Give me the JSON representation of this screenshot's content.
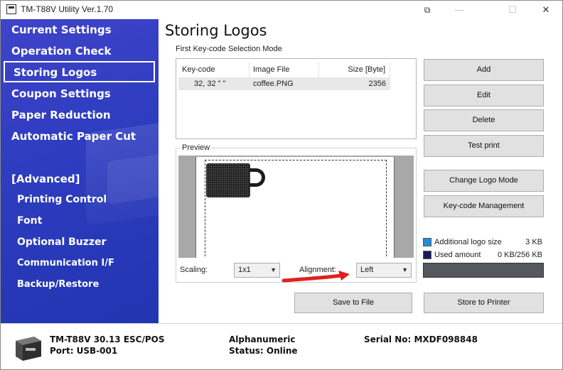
{
  "window": {
    "title": "TM-T88V Utility Ver.1.70"
  },
  "sidebar": {
    "items": [
      {
        "label": "Current Settings"
      },
      {
        "label": "Operation Check"
      },
      {
        "label": "Storing Logos"
      },
      {
        "label": "Coupon Settings"
      },
      {
        "label": "Paper Reduction"
      },
      {
        "label": "Automatic Paper Cut"
      },
      {
        "label": "[Advanced]"
      },
      {
        "label": "Printing Control"
      },
      {
        "label": "Font"
      },
      {
        "label": "Optional Buzzer"
      },
      {
        "label": "Communication I/F"
      },
      {
        "label": "Backup/Restore"
      }
    ],
    "active": "Storing Logos"
  },
  "main": {
    "title": "Storing Logos",
    "mode_label": "First Key-code Selection Mode",
    "table": {
      "columns": [
        "Key-code",
        "Image File",
        "Size [Byte]"
      ],
      "rows": [
        {
          "keycode": "32, 32  \" \"",
          "file": "coffee.PNG",
          "size": "2356"
        }
      ]
    },
    "preview": {
      "label": "Preview",
      "scaling_label": "Scaling:",
      "scaling_value": "1x1",
      "alignment_label": "Alignment:",
      "alignment_value": "Left"
    },
    "buttons": {
      "add": "Add",
      "edit": "Edit",
      "delete": "Delete",
      "test_print": "Test print",
      "change_logo_mode": "Change Logo Mode",
      "keycode_management": "Key-code Management",
      "save_to_file": "Save to File",
      "store_to_printer": "Store to Printer"
    },
    "usage": {
      "additional_label": "Additional logo size",
      "additional_value": "3 KB",
      "used_label": "Used amount",
      "used_value": "0 KB/256 KB",
      "bar_fill": 0.0,
      "colors": {
        "additional": "#1e8fd8",
        "used": "#1b1b5e",
        "bar": "#55585f"
      }
    }
  },
  "status": {
    "model": "TM-T88V 30.13 ESC/POS",
    "port": "Port: USB-001",
    "charset": "Alphanumeric",
    "status": "Status: Online",
    "serial": "Serial No: MXDF098848"
  },
  "colors": {
    "sidebar": "#2f3dc0",
    "arrow": "#e02020"
  }
}
